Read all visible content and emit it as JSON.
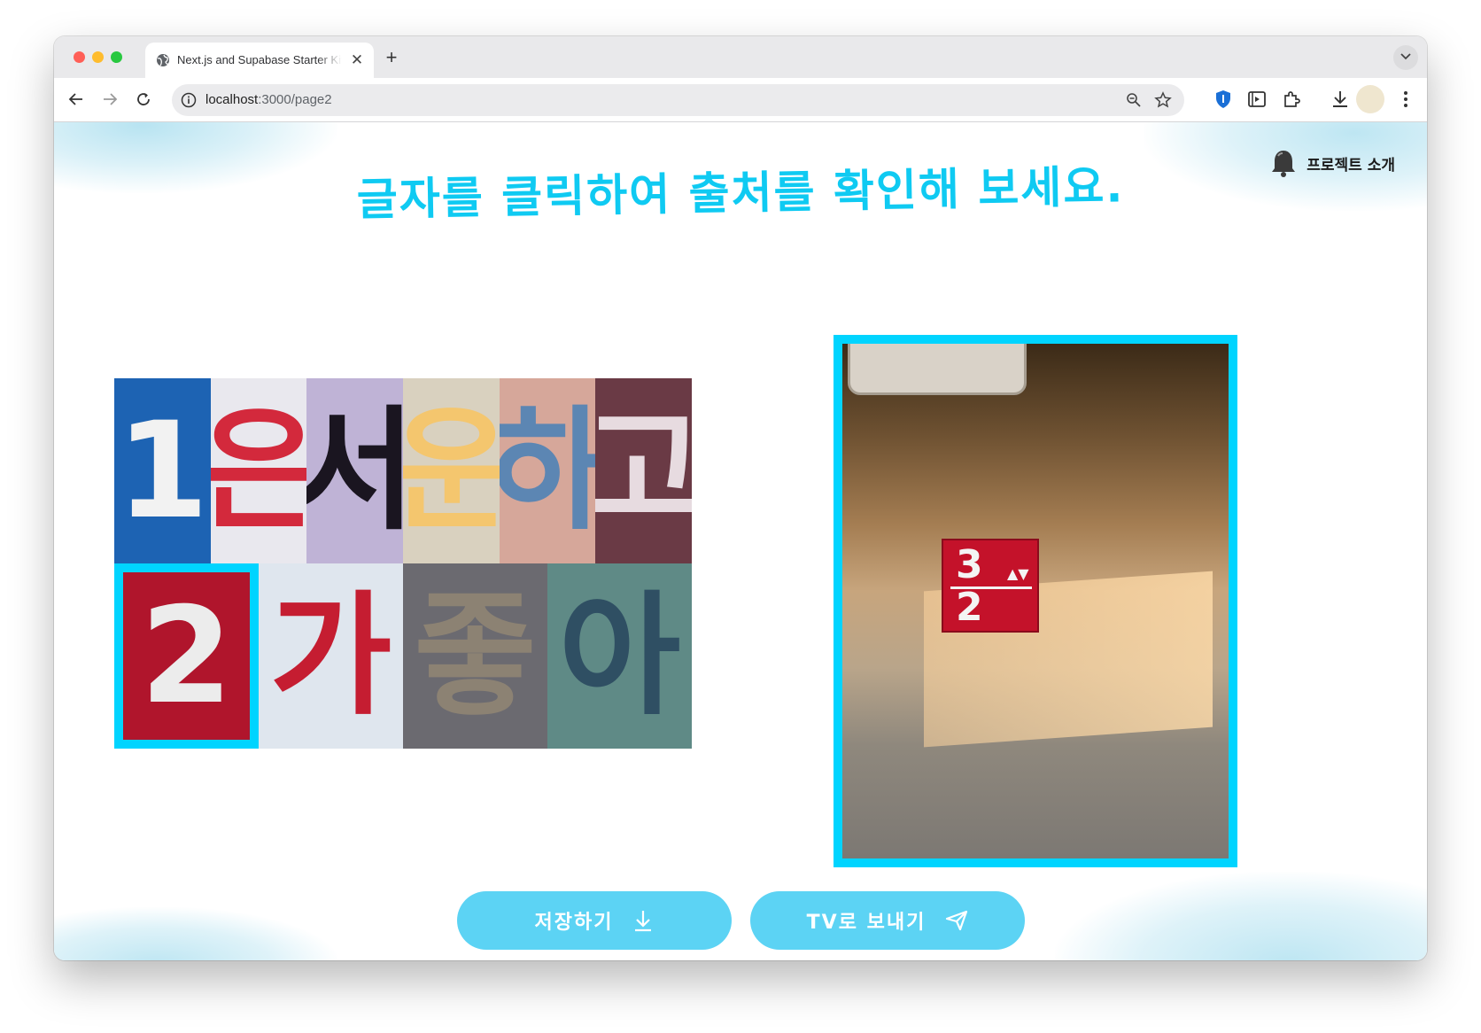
{
  "browser": {
    "tab_title": "Next.js and Supabase Starter Kit",
    "url_host": "localhost",
    "url_rest": ":3000/page2"
  },
  "page": {
    "heading": "글자를 클릭하여 출처를 확인해 보세요.",
    "intro_label": "프로젝트 소개"
  },
  "mosaic": {
    "row1": [
      {
        "glyph": "1",
        "bg": "#1d63b3",
        "fg": "#f2f2f2"
      },
      {
        "glyph": "은",
        "bg": "#e9e8ee",
        "fg": "#d3293c"
      },
      {
        "glyph": "서",
        "bg": "#bfb3d6",
        "fg": "#1a1520"
      },
      {
        "glyph": "운",
        "bg": "#d9d1bf",
        "fg": "#f4c66e"
      },
      {
        "glyph": "하",
        "bg": "#d6a79a",
        "fg": "#5c86b3"
      },
      {
        "glyph": "고",
        "bg": "#6a3a45",
        "fg": "#e7dbe0"
      }
    ],
    "row2": [
      {
        "glyph": "2",
        "bg": "#b0152c",
        "fg": "#ececec",
        "selected": true
      },
      {
        "glyph": "가",
        "bg": "#dfe6ee",
        "fg": "#c51d31"
      },
      {
        "glyph": "좋",
        "bg": "#6b6a70",
        "fg": "#8c8273"
      },
      {
        "glyph": "아",
        "bg": "#5f8a86",
        "fg": "#2f4f63"
      }
    ]
  },
  "photo": {
    "sign_top": "3",
    "sign_bottom": "2",
    "sign_arrows": "▲▼"
  },
  "buttons": {
    "save": "저장하기",
    "send_tv": "TV로 보내기"
  },
  "colors": {
    "accent": "#00d4ff",
    "heading": "#0fcaf2",
    "button": "#5cd3f4"
  }
}
